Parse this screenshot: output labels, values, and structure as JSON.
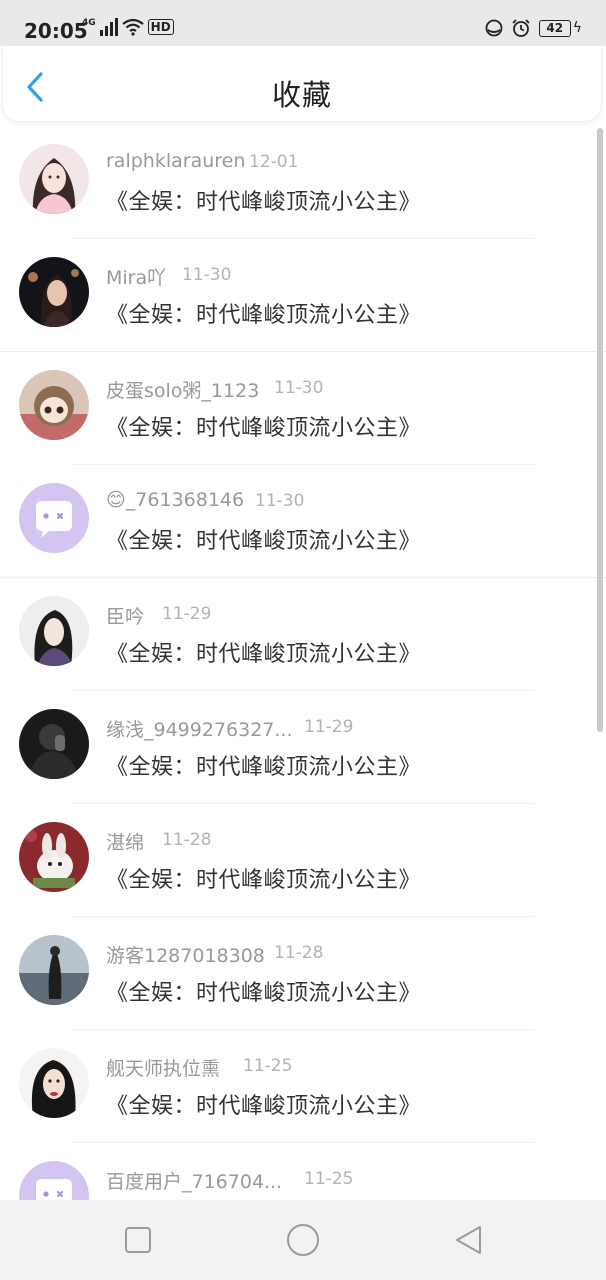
{
  "status_bar": {
    "time": "20:05",
    "network": "4G",
    "hd_label": "HD",
    "battery": "42"
  },
  "header": {
    "title": "收藏",
    "back_icon": "chevron-left-icon",
    "accent_color": "#2aa3e8"
  },
  "list": {
    "items": [
      {
        "username": "ralphklarauren",
        "date": "12-01",
        "book_title": "《全娱：时代峰峻顶流小公主》"
      },
      {
        "username": "Mira吖",
        "date": "11-30",
        "book_title": "《全娱：时代峰峻顶流小公主》"
      },
      {
        "username": "皮蛋solo粥_1123",
        "date": "11-30",
        "book_title": "《全娱：时代峰峻顶流小公主》"
      },
      {
        "username": "😊_761368146",
        "date": "11-30",
        "book_title": "《全娱：时代峰峻顶流小公主》"
      },
      {
        "username": "臣吟",
        "date": "11-29",
        "book_title": "《全娱：时代峰峻顶流小公主》"
      },
      {
        "username": "缘浅_9499276327...",
        "date": "11-29",
        "book_title": "《全娱：时代峰峻顶流小公主》"
      },
      {
        "username": "湛绵",
        "date": "11-28",
        "book_title": "《全娱：时代峰峻顶流小公主》"
      },
      {
        "username": "游客1287018308",
        "date": "11-28",
        "book_title": "《全娱：时代峰峻顶流小公主》"
      },
      {
        "username": "舰天师执位熏",
        "date": "11-25",
        "book_title": "《全娱：时代峰峻顶流小公主》"
      },
      {
        "username": "百度用户_716704...",
        "date": "11-25",
        "book_title": ""
      }
    ]
  },
  "nav_bar": {
    "recent_icon": "square-icon",
    "home_icon": "circle-icon",
    "back_icon": "triangle-back-icon"
  }
}
